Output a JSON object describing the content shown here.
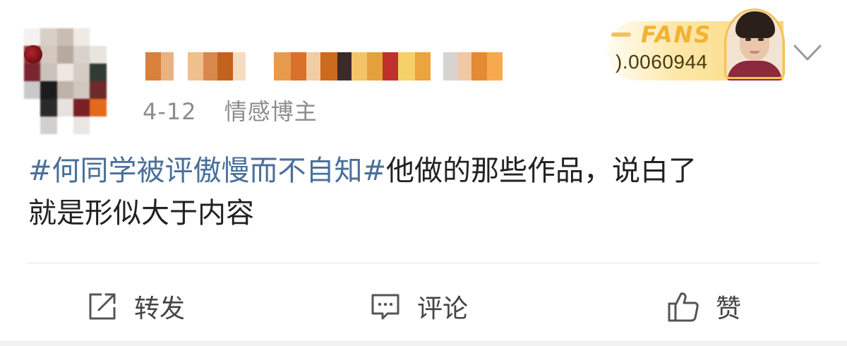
{
  "post": {
    "date": "4-12",
    "user_tag": "情感博主",
    "hashtag": "#何同学被评傲慢而不自知#",
    "body_line1": "他做的那些作品，说白了",
    "body_line2": "就是形似大于内容"
  },
  "fans_badge": {
    "label": "FANS",
    "number": ").0060944"
  },
  "actions": {
    "repost_label": "转发",
    "comment_label": "评论",
    "like_label": "赞"
  },
  "colors": {
    "hashtag": "#4a6f9a",
    "text": "#222222",
    "meta": "#8c8c8c",
    "badge_gold": "#f2b233"
  },
  "icons": {
    "more": "chevron-down-icon",
    "repost": "repost-icon",
    "comment": "comment-icon",
    "like": "thumbs-up-icon"
  }
}
